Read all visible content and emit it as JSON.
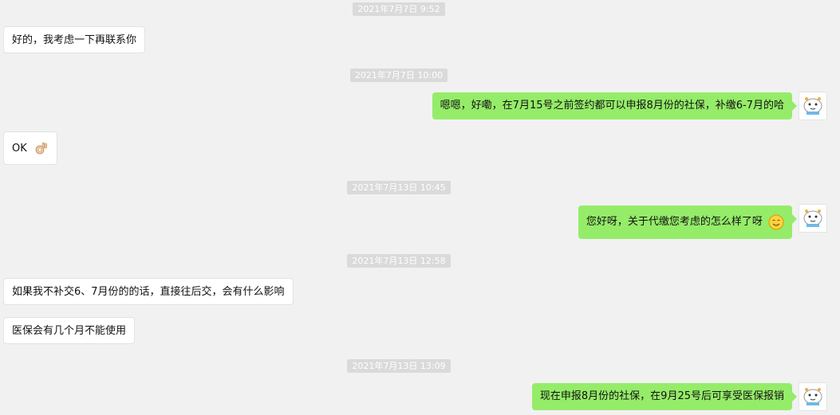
{
  "messages": {
    "ts1": "2021年7月7日 9:52",
    "m1": "好的，我考虑一下再联系你",
    "ts2": "2021年7月7日 10:00",
    "m2": "嗯嗯，好嘞，在7月15号之前签约都可以申报8月份的社保，补缴6-7月的哈",
    "m3": "OK",
    "ts3": "2021年7月13日 10:45",
    "m4": "您好呀，关于代缴您考虑的怎么样了呀",
    "ts4": "2021年7月13日 12:58",
    "m5": "如果我不补交6、7月份的的话，直接往后交，会有什么影响",
    "m6": "医保会有几个月不能使用",
    "ts5": "2021年7月13日 13:09",
    "m7": "现在申报8月份的社保，在9月25号后可享受医保报销"
  },
  "icons": {
    "ok_emoji": "ok-hand-icon",
    "smile_emoji": "smile-icon",
    "avatar": "cartoon-avatar"
  }
}
